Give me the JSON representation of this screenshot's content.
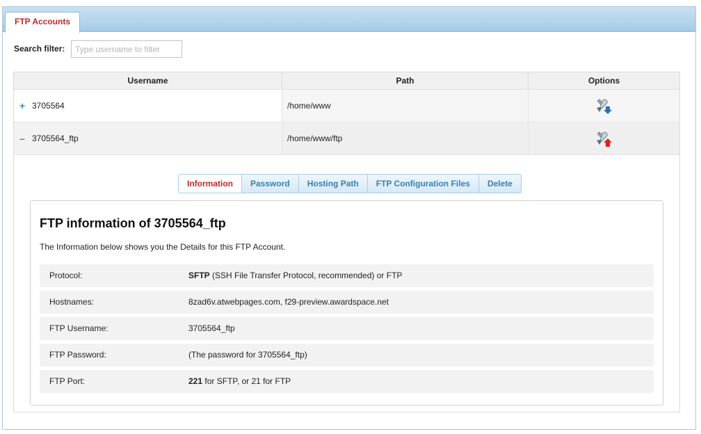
{
  "tabs": [
    {
      "label": "FTP Accounts",
      "active": true
    }
  ],
  "search": {
    "label": "Search filter:",
    "placeholder": "Type username to filter",
    "value": ""
  },
  "table": {
    "headers": [
      "Username",
      "Path",
      "Options"
    ],
    "rows": [
      {
        "toggle": "+",
        "username": "3705564",
        "path": "/home/www",
        "option_icon": "tools-expand-icon",
        "expanded": false
      },
      {
        "toggle": "–",
        "username": "3705564_ftp",
        "path": "/home/www/ftp",
        "option_icon": "tools-collapse-icon",
        "expanded": true
      }
    ]
  },
  "subtabs": [
    {
      "label": "Information",
      "active": true
    },
    {
      "label": "Password",
      "active": false
    },
    {
      "label": "Hosting Path",
      "active": false
    },
    {
      "label": "FTP Configuration Files",
      "active": false
    },
    {
      "label": "Delete",
      "active": false
    }
  ],
  "info": {
    "title": "FTP information of 3705564_ftp",
    "description": "The Information below shows you the Details for this FTP Account.",
    "rows": [
      {
        "label": "Protocol:",
        "bold": "SFTP",
        "value": " (SSH File Transfer Protocol, recommended) or FTP"
      },
      {
        "label": "Hostnames:",
        "bold": "",
        "value": "8zad6v.atwebpages.com, f29-preview.awardspace.net"
      },
      {
        "label": "FTP Username:",
        "bold": "",
        "value": "3705564_ftp"
      },
      {
        "label": "FTP Password:",
        "bold": "",
        "value": "(The password for 3705564_ftp)"
      },
      {
        "label": "FTP Port:",
        "bold": "221",
        "value": " for SFTP, or 21 for FTP"
      }
    ]
  },
  "colors": {
    "accent_red": "#c0272d",
    "link_blue": "#3a7fb3",
    "tabbar_blue": "#a4cbe8"
  }
}
